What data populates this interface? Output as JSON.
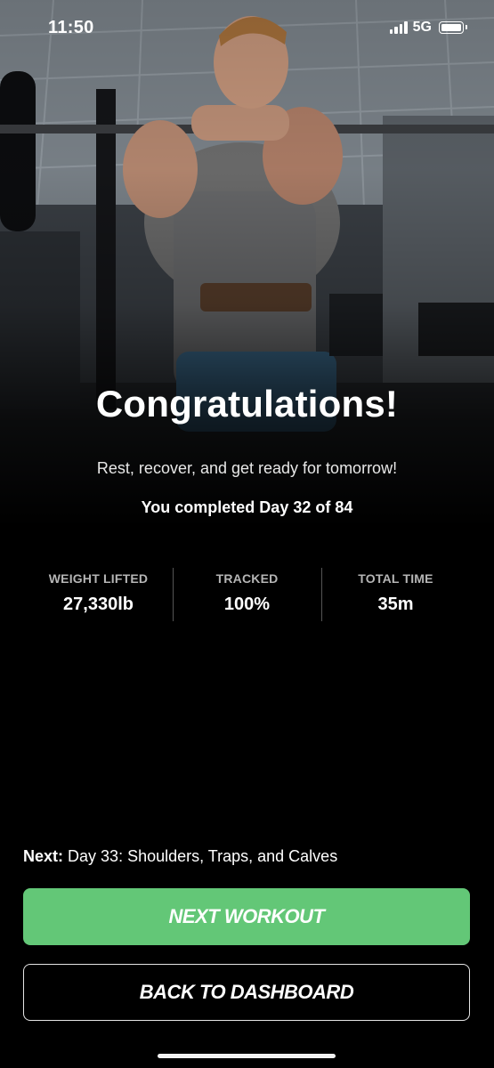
{
  "status_bar": {
    "time": "11:50",
    "network": "5G",
    "icons": [
      "signal-icon",
      "battery-icon"
    ]
  },
  "hero": {
    "icon": "hero-athlete-image"
  },
  "main": {
    "headline": "Congratulations!",
    "subtitle": "Rest, recover, and get ready for tomorrow!",
    "completed": "You completed Day 32 of 84"
  },
  "stats": [
    {
      "label": "WEIGHT LIFTED",
      "value": "27,330lb"
    },
    {
      "label": "TRACKED",
      "value": "100%"
    },
    {
      "label": "TOTAL TIME",
      "value": "35m"
    }
  ],
  "next": {
    "prefix": "Next:",
    "text": "Day 33: Shoulders, Traps, and Calves"
  },
  "buttons": {
    "next_workout": "NEXT WORKOUT",
    "back_to_dashboard": "BACK TO DASHBOARD"
  },
  "colors": {
    "accent": "#63c777",
    "background": "#000000"
  }
}
